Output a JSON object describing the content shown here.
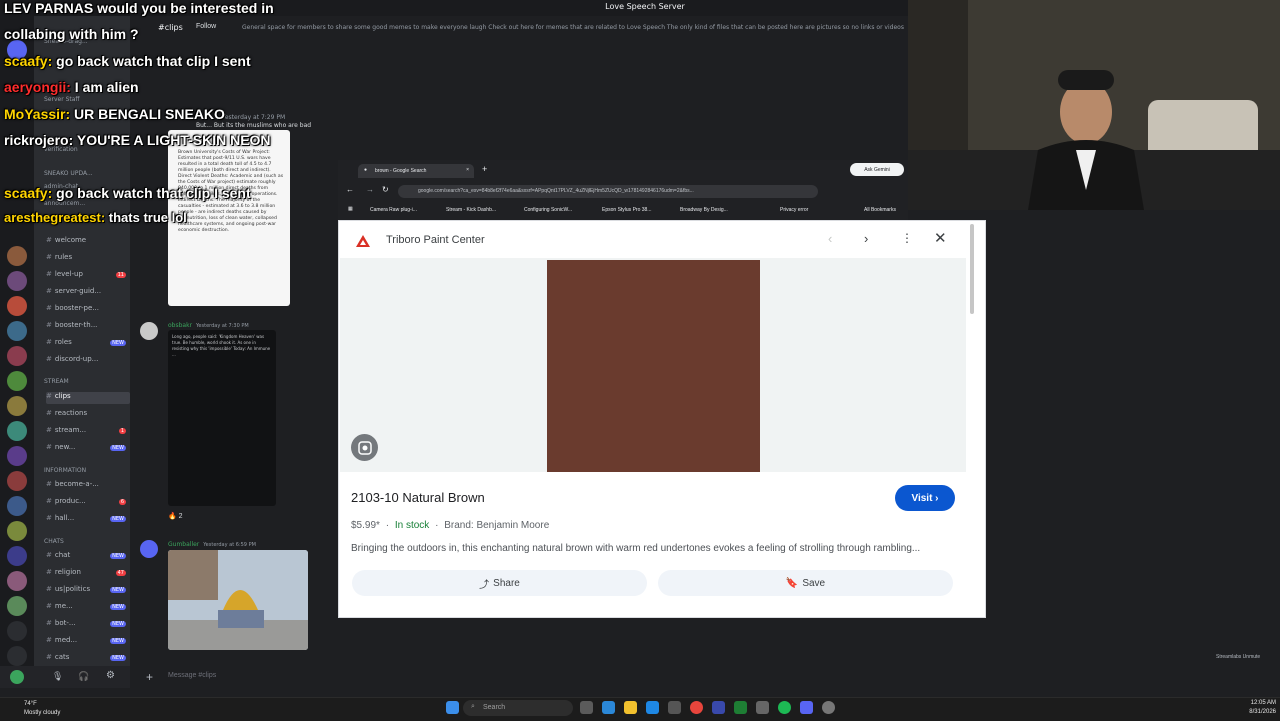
{
  "discord": {
    "server_title": "Love Speech Server",
    "channel_name": "clips",
    "follow_label": "Follow",
    "topic": "General space for members to share some good memes to make everyone laugh Check out here for memes that are related to Love Speech The only kind of files that can be posted here are pictures so no links or videos",
    "categories": [
      "STREAM",
      "INFORMATION",
      "CHATS"
    ],
    "channels": [
      {
        "label": "welcome",
        "badge": ""
      },
      {
        "label": "rules",
        "badge": ""
      },
      {
        "label": "level-up",
        "badge": "11"
      },
      {
        "label": "server-guid...",
        "badge": ""
      },
      {
        "label": "booster-pe...",
        "badge": ""
      },
      {
        "label": "booster-th...",
        "badge": ""
      },
      {
        "label": "roles",
        "badge": "NEW"
      },
      {
        "label": "discord-up...",
        "badge": ""
      },
      {
        "label": "clips",
        "badge": ""
      },
      {
        "label": "reactions",
        "badge": ""
      },
      {
        "label": "stream...",
        "badge": "1"
      },
      {
        "label": "new...",
        "badge": "NEW"
      },
      {
        "label": "become-a-...",
        "badge": ""
      },
      {
        "label": "produc...",
        "badge": "6"
      },
      {
        "label": "hall...",
        "badge": "NEW"
      },
      {
        "label": "chat",
        "badge": "NEW"
      },
      {
        "label": "religion",
        "badge": "47"
      },
      {
        "label": "us|politics",
        "badge": "NEW"
      },
      {
        "label": "me...",
        "badge": "NEW"
      },
      {
        "label": "bot-...",
        "badge": "NEW"
      },
      {
        "label": "med...",
        "badge": "NEW"
      },
      {
        "label": "cats",
        "badge": "NEW"
      }
    ],
    "misc_sidebar": [
      "Sneako-drag...",
      "Server Staff",
      "verification",
      "SNEAKO UPDA...",
      "admin-chat",
      "announcem..."
    ],
    "messages": [
      {
        "author": "",
        "timestamp": "Yesterday at 7:29 PM",
        "excerpt": "But... But its the muslims who are bad"
      },
      {
        "author": "obsbakr",
        "timestamp": "Yesterday at 7:30 PM",
        "reactions": "2"
      },
      {
        "author": "Gumballer",
        "timestamp": "Yesterday at 6:59 PM"
      }
    ],
    "card1_text": "Brown University's Costs of War Project: Estimates that post-9/11 U.S. wars have resulted in a total death toll of 4.5 to 4.7 million people (both direct and indirect). Direct Violent Deaths: Academic and (such as the Costs of War project) estimate roughly 940,000 to 1 million direct deaths from fighting, airstrikes, and military operations. Indirect Deaths: The majority of the casualties - estimated at 3.6 to 3.8 million people - are indirect deaths caused by malnutrition, loss of clean water, collapsed healthcare systems, and ongoing post-war economic destruction.",
    "card2_text": "Long ago, people said: 'Kingdom Heaven' was true. Be humble, world shook it. As one in resisting why this 'impossible' Today: An Immune ...",
    "composer_placeholder": "Message #clips"
  },
  "chat_overlay": [
    {
      "user": "",
      "message": "LEV PARNAS would you be interested in",
      "color": "#ffffff"
    },
    {
      "user": "",
      "message": "collabing with him ?",
      "color": "#ffffff"
    },
    {
      "user": "scaafy:",
      "message": "go back watch that clip I sent",
      "color": "#ffd400"
    },
    {
      "user": "aeryongii:",
      "message": "I am alien",
      "color": "#ff2d2d"
    },
    {
      "user": "MoYassir:",
      "message": "UR BENGALI SNEAKO",
      "color": "#ffd400"
    },
    {
      "user": "rickrojero:",
      "message": "YOU'RE A LIGHT-SKIN NEON",
      "color": "#ffffff"
    },
    {
      "user": "scaafy:",
      "message": "go back watch that clip I sent",
      "color": "#ffd400"
    },
    {
      "user": "aresthegreatest:",
      "message": "thats true lol",
      "color": "#ffd400"
    }
  ],
  "browser": {
    "tab_title": "brown - Google Search",
    "url": "google.com/search?ca_esv=84b8ef2f74e6aa&sxsrf=APpqQnt17PLVZ_4uZNjlEjHm5ZUcQD_w1781492846176udm=2&fbs...",
    "ask_gemini": "Ask Gemini",
    "bookmarks": [
      "Camera Raw plug-i...",
      "Stream - Kick Dashb...",
      "Configuring SonicW...",
      "Epson Stylus Pro 38...",
      "Broadway By Desig...",
      "Privacy error"
    ],
    "all_bookmarks": "All Bookmarks"
  },
  "product": {
    "site_name": "Triboro Paint Center",
    "title": "2103-10 Natural Brown",
    "price": "$5.99*",
    "stock": "In stock",
    "brand": "Brand: Benjamin Moore",
    "description": "Bringing the outdoors in, this enchanting natural brown with warm red undertones evokes a feeling of strolling through rambling...",
    "visit_label": "Visit",
    "share_label": "Share",
    "save_label": "Save",
    "swatch_color": "#6a3b2e",
    "accent_color": "#0b57d0"
  },
  "taskbar": {
    "search_placeholder": "Search",
    "weather_temp": "74°F",
    "weather_desc": "Mostly cloudy",
    "time": "12:05 AM",
    "date": "8/31/2026",
    "streamlabs_note": "Streamlabs Unmute"
  }
}
